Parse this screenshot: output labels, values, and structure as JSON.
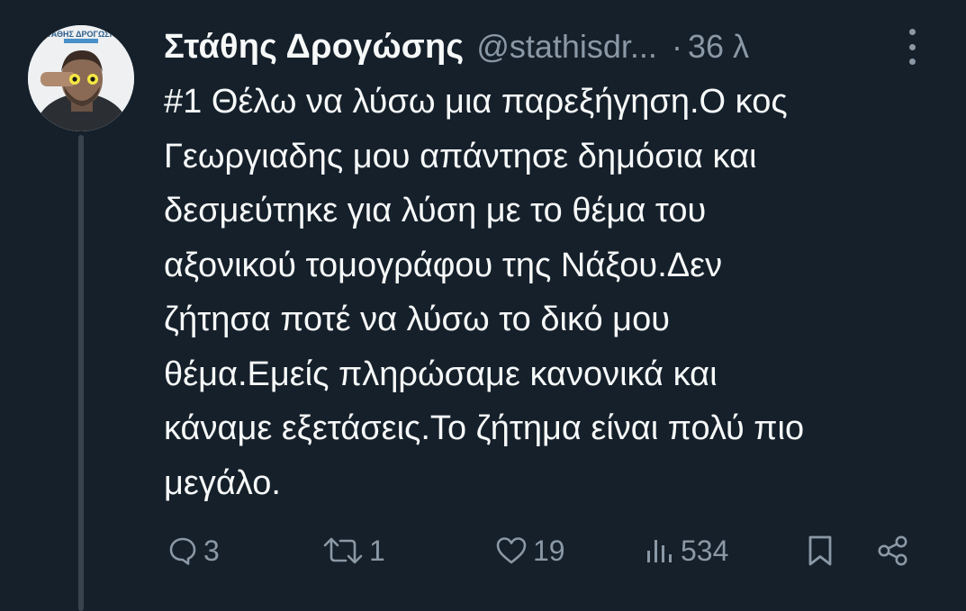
{
  "tweet": {
    "author_name": "Στάθης Δρογώσης",
    "handle": "@stathisdr...",
    "separator": "·",
    "time": "36 λ",
    "text_lines": [
      "#1 Θέλω να λύσω μια παρεξήγηση.Ο κος",
      "Γεωργιαδης μου απάντησε δημόσια και",
      "δεσμεύτηκε για λύση με το θέμα του",
      "αξονικού τομογράφου της Νάξου.Δεν",
      "ζήτησα ποτέ να λύσω το δικό μου",
      "θέμα.Εμείς πληρώσαμε κανονικά και",
      "κάναμε εξετάσεις.Το ζήτημα είναι πολύ πιο",
      "μεγάλο."
    ],
    "avatar_caption": "ΣΤΑΘΗΣ ΔΡΟΓΩΣΗΣ"
  },
  "actions": {
    "reply_count": "3",
    "retweet_count": "1",
    "like_count": "19",
    "views_count": "534"
  },
  "icons": [
    "reply-icon",
    "retweet-icon",
    "like-icon",
    "views-icon",
    "bookmark-icon",
    "share-icon",
    "more-icon"
  ],
  "colors": {
    "background": "#15202b",
    "primary_text": "#f7f9f9",
    "secondary_text": "#8b98a5",
    "thread_line": "#38444d"
  }
}
